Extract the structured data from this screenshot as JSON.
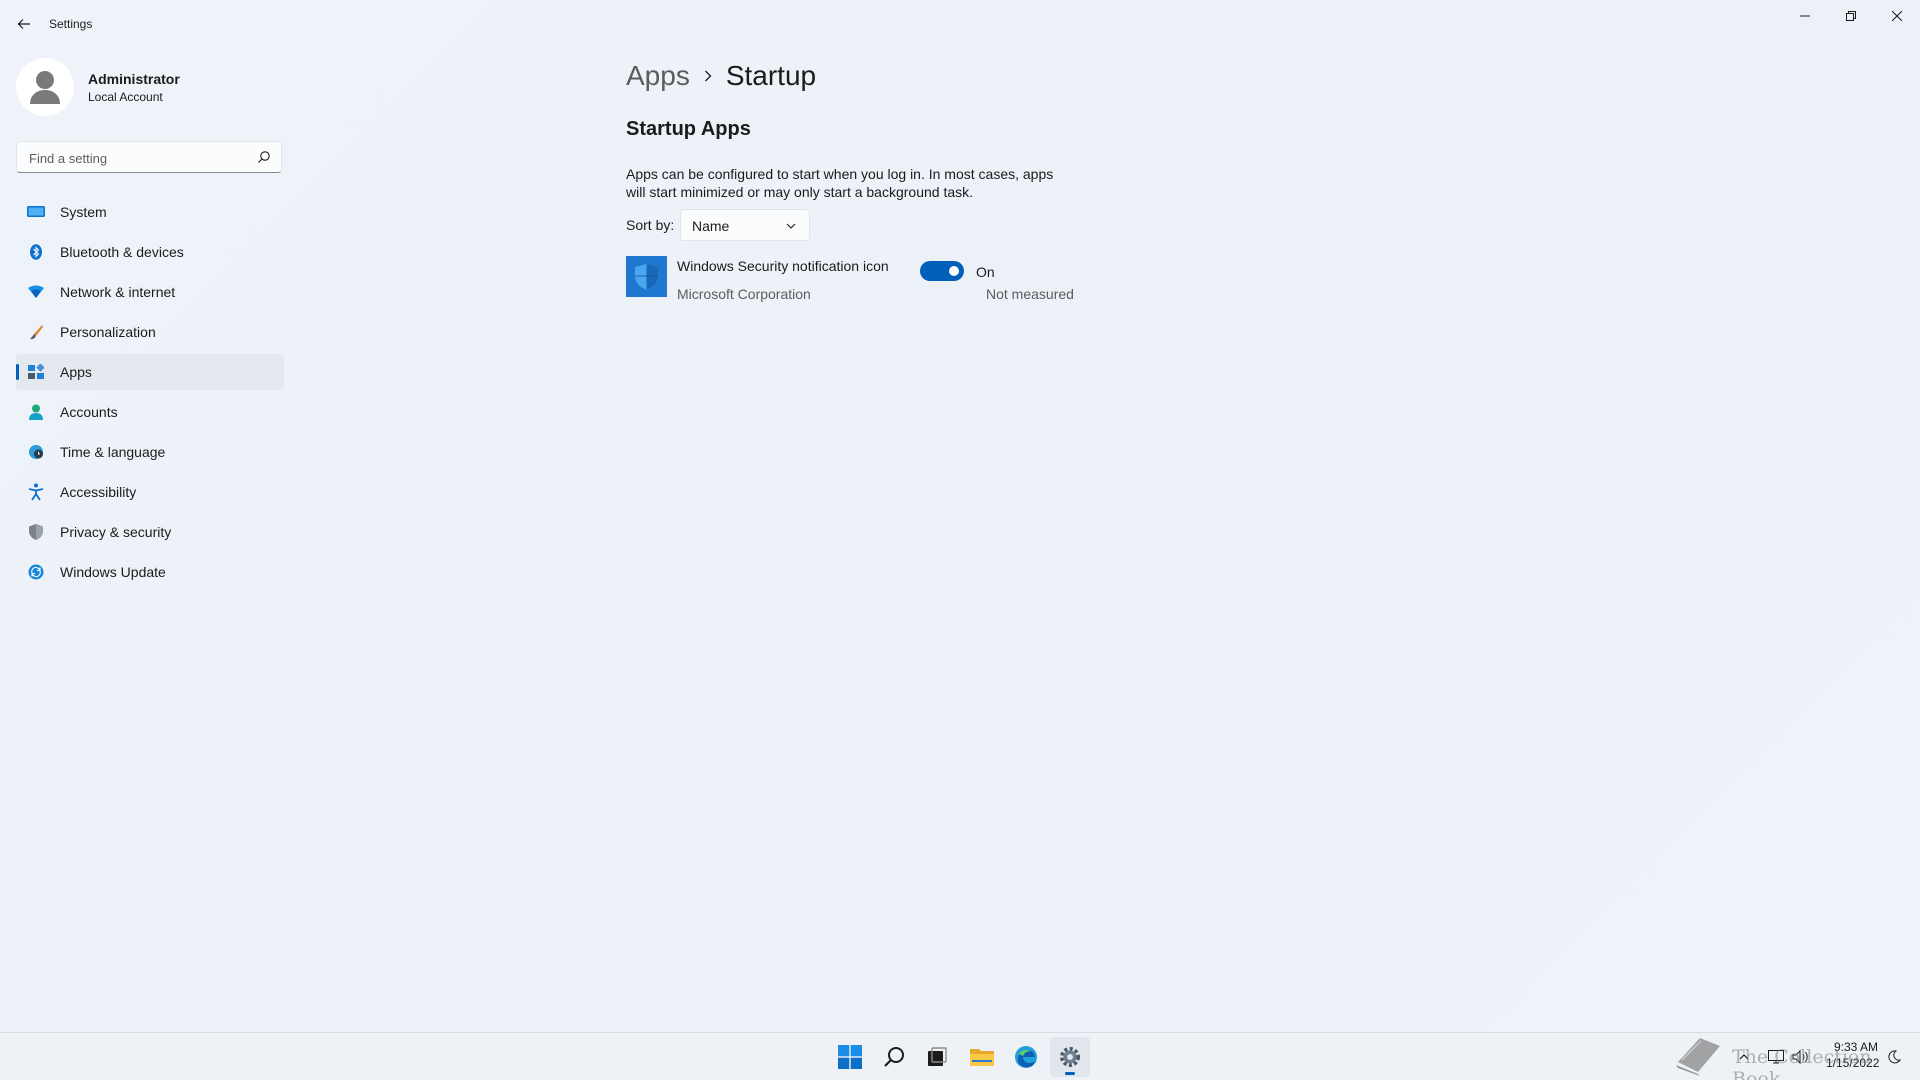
{
  "window": {
    "title": "Settings"
  },
  "profile": {
    "name": "Administrator",
    "account_type": "Local Account"
  },
  "search": {
    "placeholder": "Find a setting",
    "value": ""
  },
  "nav": {
    "selected": "Apps",
    "items": [
      {
        "label": "System",
        "icon": "monitor-icon"
      },
      {
        "label": "Bluetooth & devices",
        "icon": "bluetooth-icon"
      },
      {
        "label": "Network & internet",
        "icon": "wifi-icon"
      },
      {
        "label": "Personalization",
        "icon": "brush-icon"
      },
      {
        "label": "Apps",
        "icon": "apps-icon"
      },
      {
        "label": "Accounts",
        "icon": "person-icon"
      },
      {
        "label": "Time & language",
        "icon": "globe-clock-icon"
      },
      {
        "label": "Accessibility",
        "icon": "accessibility-icon"
      },
      {
        "label": "Privacy & security",
        "icon": "shield-icon"
      },
      {
        "label": "Windows Update",
        "icon": "update-icon"
      }
    ]
  },
  "breadcrumb": {
    "parent": "Apps",
    "current": "Startup"
  },
  "content": {
    "section_title": "Startup Apps",
    "description": "Apps can be configured to start when you log in. In most cases, apps will start minimized or may only start a background task.",
    "sort_label": "Sort by:",
    "sort_value": "Name"
  },
  "startup_apps": [
    {
      "name": "Windows Security notification icon",
      "publisher": "Microsoft Corporation",
      "enabled": true,
      "state_label": "On",
      "impact": "Not measured"
    }
  ],
  "taskbar": {
    "pinned": [
      "windows-start-icon",
      "search-icon",
      "task-view-icon",
      "file-explorer-icon",
      "edge-icon",
      "settings-gear-icon"
    ],
    "active": "settings-gear-icon",
    "time": "9:33 AM",
    "date": "1/15/2022"
  },
  "watermark": {
    "text": "The Collection Book"
  },
  "colors": {
    "accent": "#005fb8",
    "background": "#eef2f8"
  }
}
